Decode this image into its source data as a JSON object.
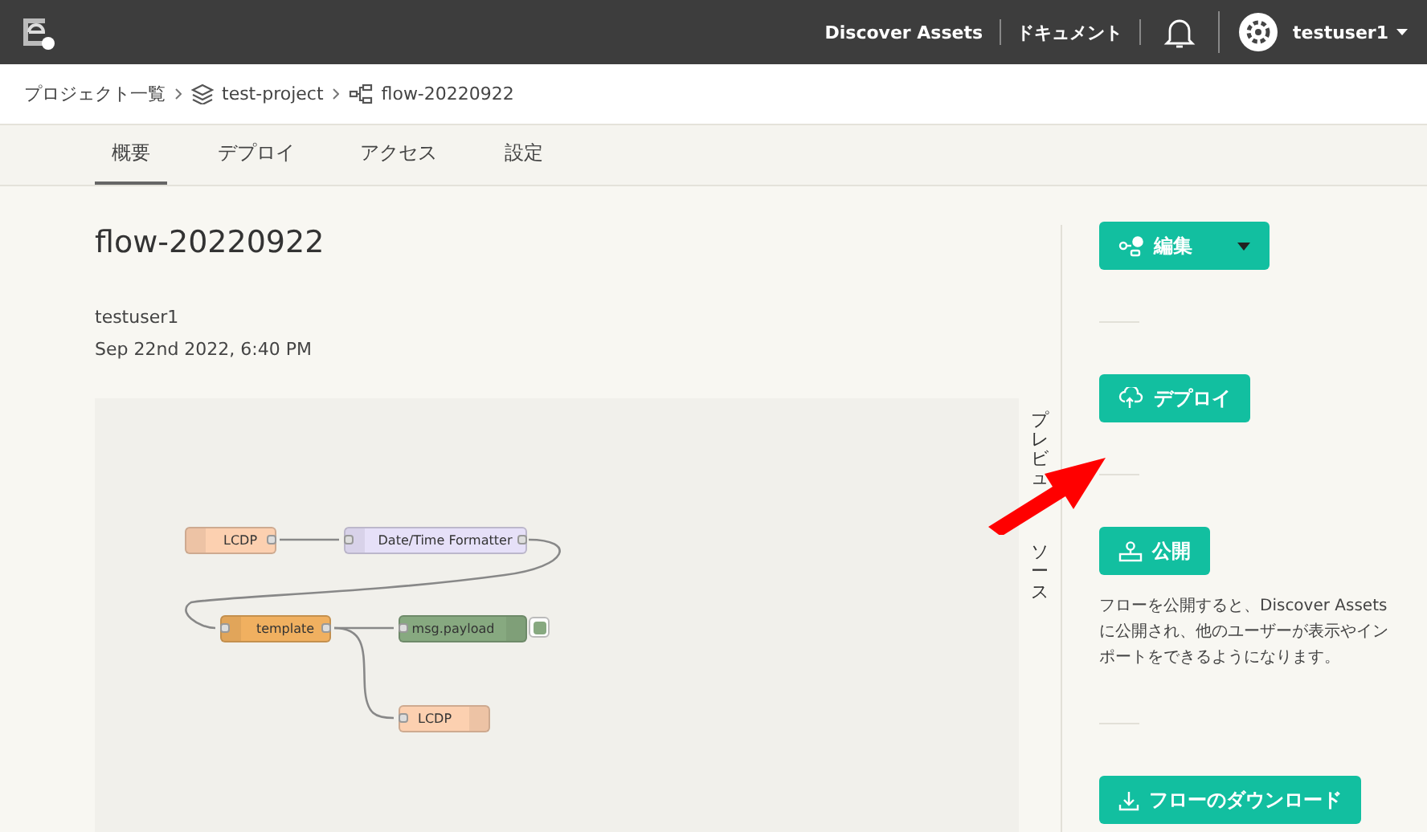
{
  "header": {
    "links": [
      "Discover Assets",
      "ドキュメント"
    ],
    "user": "testuser1"
  },
  "breadcrumb": [
    {
      "label": "プロジェクト一覧",
      "kind": "text"
    },
    {
      "label": "test-project",
      "kind": "project"
    },
    {
      "label": "flow-20220922",
      "kind": "flow"
    }
  ],
  "tabs": [
    {
      "label": "概要",
      "selected": true
    },
    {
      "label": "デプロイ",
      "selected": false
    },
    {
      "label": "アクセス",
      "selected": false
    },
    {
      "label": "設定",
      "selected": false
    }
  ],
  "flow": {
    "title": "flow-20220922",
    "author": "testuser1",
    "date": "Sep 22nd 2022, 6:40 PM"
  },
  "preview_tabs": [
    "プレビュ",
    "ソース"
  ],
  "nodes": [
    {
      "label": "LCDP",
      "kind": "source",
      "color": "#fcd0b0"
    },
    {
      "label": "Date/Time Formatter",
      "kind": "function",
      "color": "#e6e0f8"
    },
    {
      "label": "template",
      "kind": "function",
      "color": "#f0b060"
    },
    {
      "label": "msg.payload",
      "kind": "debug",
      "color": "#87a980"
    },
    {
      "label": "LCDP",
      "kind": "sink",
      "color": "#fcd0b0"
    }
  ],
  "actions": [
    {
      "label": "編集",
      "kind": "edit"
    },
    {
      "label": "デプロイ",
      "kind": "deploy"
    },
    {
      "label": "公開",
      "kind": "publish",
      "description": "フローを公開すると、Discover Assets に公開され、他のユーザーが表示やインポートをできるようになります。"
    },
    {
      "label": "フローのダウンロード",
      "kind": "download"
    }
  ]
}
